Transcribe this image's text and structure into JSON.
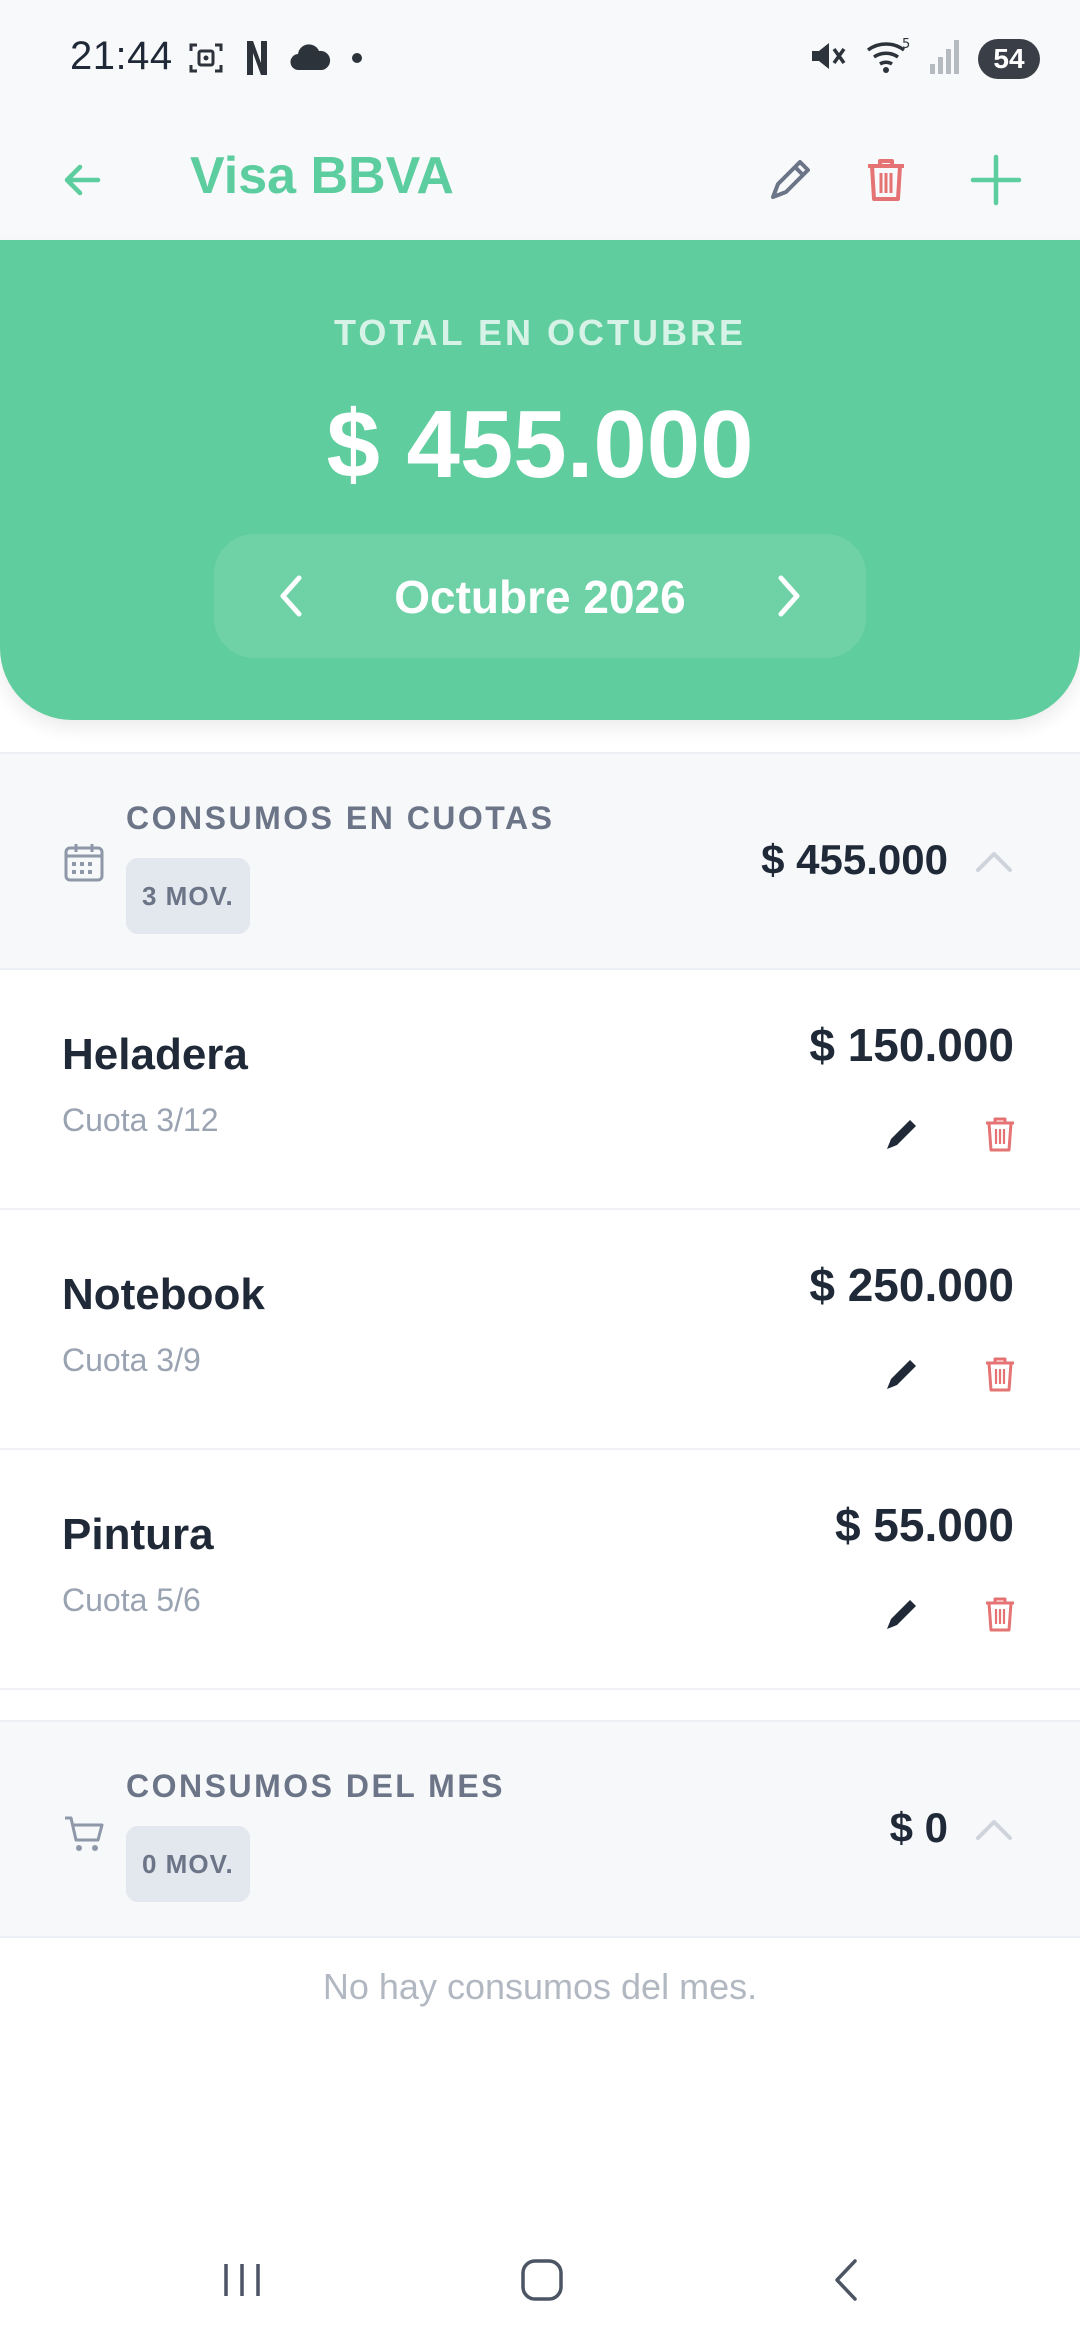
{
  "status_bar": {
    "time": "21:44",
    "battery": "54",
    "icons_left": [
      "screenshot-icon",
      "netflix-icon",
      "cloud-icon",
      "dot-icon"
    ],
    "icons_right": [
      "mute-icon",
      "wifi-icon",
      "signal-icon",
      "battery-icon"
    ]
  },
  "app_bar": {
    "title": "Visa BBVA",
    "actions": [
      "edit-icon",
      "delete-icon",
      "add-icon"
    ]
  },
  "summary": {
    "label": "TOTAL EN OCTUBRE",
    "total": "$ 455.000",
    "month": "Octubre 2026"
  },
  "installments": {
    "title": "CONSUMOS EN CUOTAS",
    "badge": "3 MOV.",
    "total": "$ 455.000",
    "items": [
      {
        "name": "Heladera",
        "detail": "Cuota 3/12",
        "amount": "$ 150.000"
      },
      {
        "name": "Notebook",
        "detail": "Cuota 3/9",
        "amount": "$ 250.000"
      },
      {
        "name": "Pintura",
        "detail": "Cuota 5/6",
        "amount": "$ 55.000"
      }
    ]
  },
  "monthly": {
    "title": "CONSUMOS DEL MES",
    "badge": "0 MOV.",
    "total": "$ 0",
    "empty_message": "No hay consumos del mes."
  },
  "colors": {
    "accent": "#5ccd9e",
    "danger": "#e57373",
    "text_dark": "#1f2937",
    "text_muted": "#9aa3b2"
  }
}
